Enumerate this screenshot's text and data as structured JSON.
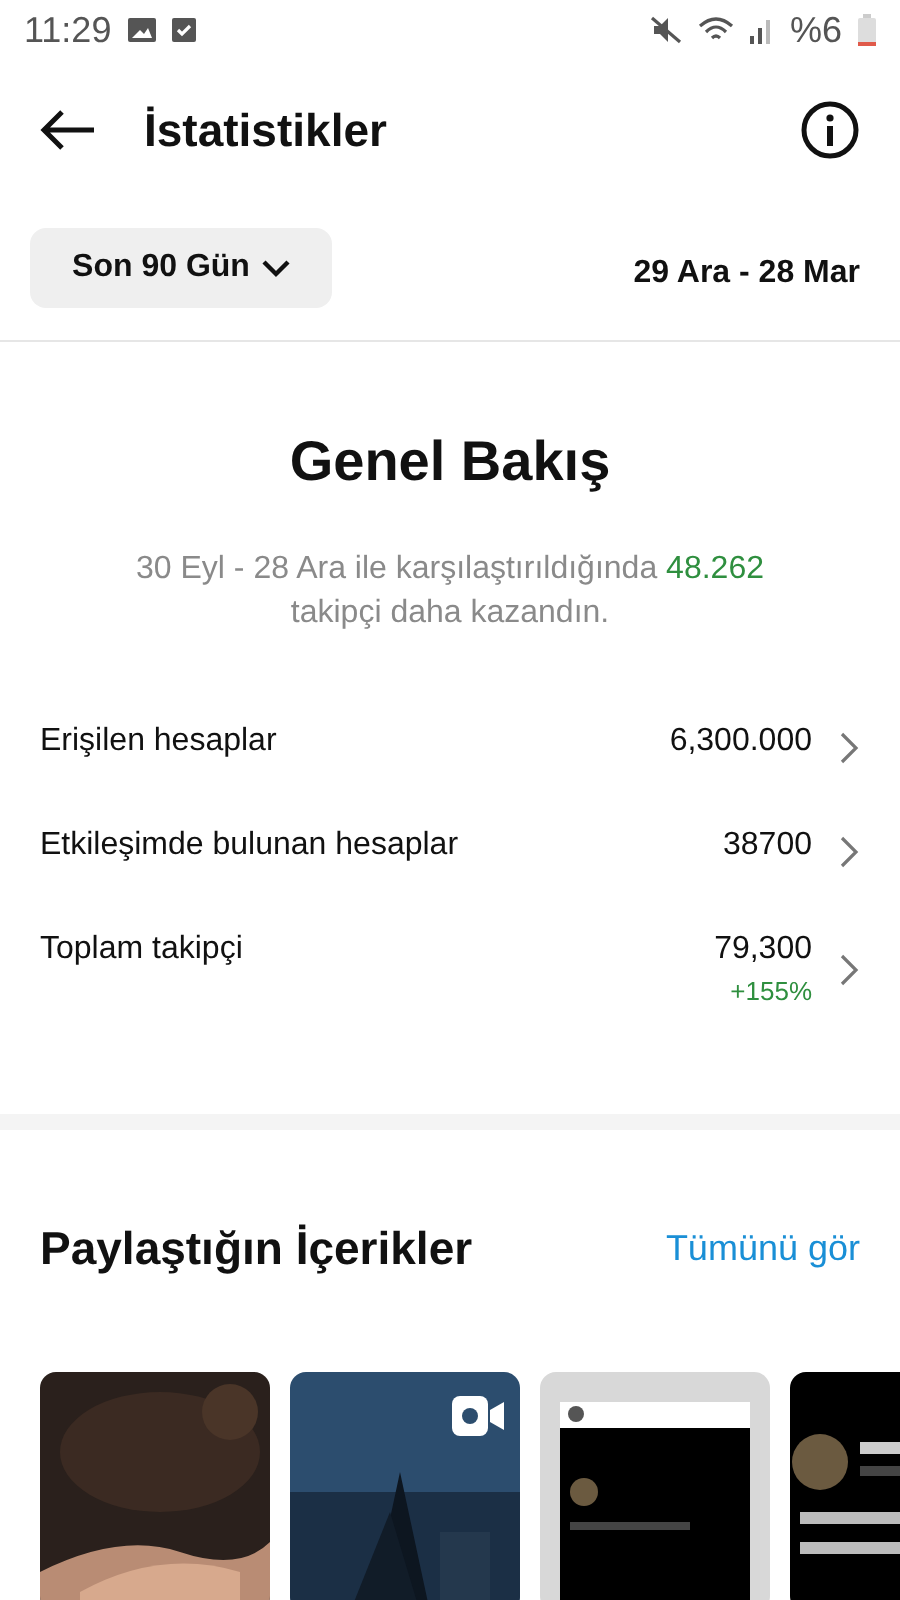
{
  "status_bar": {
    "time": "11:29",
    "battery": "%6"
  },
  "header": {
    "title": "İstatistikler"
  },
  "filter": {
    "period": "Son 90 Gün",
    "range": "29 Ara - 28 Mar"
  },
  "overview": {
    "title": "Genel Bakış",
    "comparison": "30 Eyl - 28 Ara ile karşılaştırıldığında",
    "gain": "48.262",
    "comparison_end": "takipçi daha kazandın.",
    "rows": [
      {
        "label": "Erişilen hesaplar",
        "value": "6,300.000"
      },
      {
        "label": "Etkileşimde bulunan hesaplar",
        "value": "38700"
      },
      {
        "label": "Toplam takipçi",
        "value": "79,300",
        "change": "+155%"
      }
    ]
  },
  "content": {
    "title": "Paylaştığın İçerikler",
    "link": "Tümünü gör",
    "posts": [
      {
        "kind": "picture",
        "video": false
      },
      {
        "kind": "picture",
        "video": true
      },
      {
        "kind": "picture",
        "video": false
      },
      {
        "kind": "picture",
        "video": false
      }
    ]
  }
}
